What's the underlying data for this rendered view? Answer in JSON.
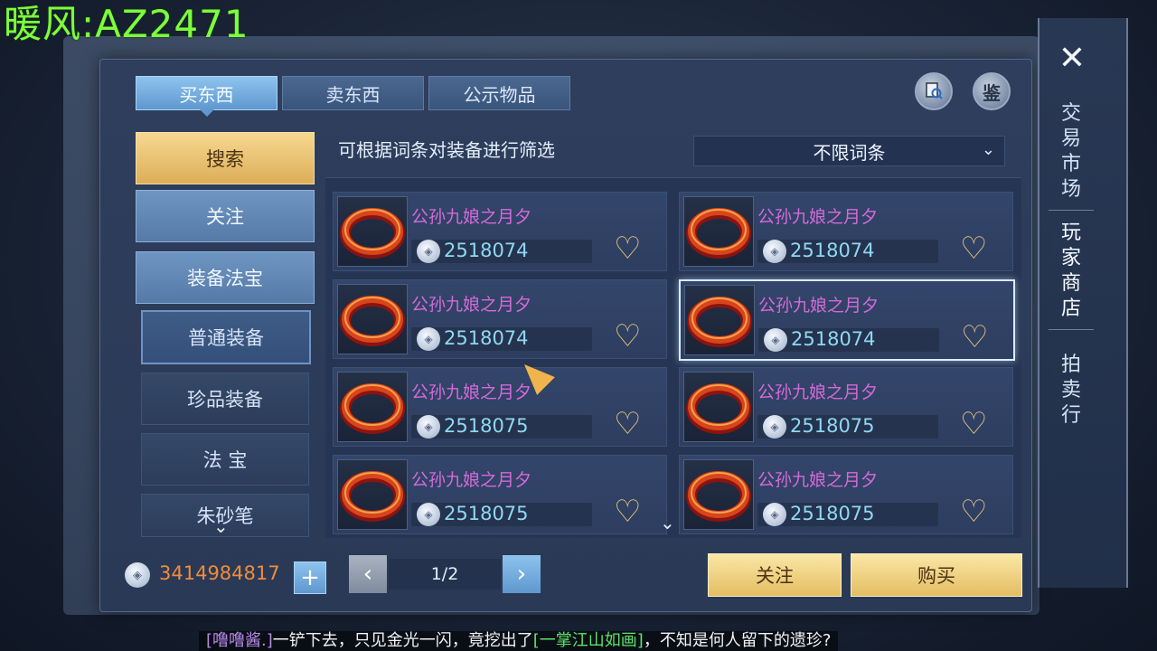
{
  "watermark": "暖风:AZ2471",
  "tabs": [
    {
      "label": "买东西",
      "active": true
    },
    {
      "label": "卖东西",
      "active": false
    },
    {
      "label": "公示物品",
      "active": false
    }
  ],
  "header_buttons": {
    "appraise_label": "鉴"
  },
  "menu": {
    "search": "搜索",
    "follow": "关注",
    "equip_treasure": "装备法宝",
    "normal_equip": "普通装备",
    "rare_equip": "珍品装备",
    "treasure": "法 宝",
    "cinnabar_pen": "朱砂笔"
  },
  "filter": {
    "label": "可根据词条对装备进行筛选",
    "selected": "不限词条"
  },
  "items": [
    {
      "name": "公孙九娘之月夕",
      "price": "2518074",
      "selected": false
    },
    {
      "name": "公孙九娘之月夕",
      "price": "2518074",
      "selected": false
    },
    {
      "name": "公孙九娘之月夕",
      "price": "2518074",
      "selected": false
    },
    {
      "name": "公孙九娘之月夕",
      "price": "2518074",
      "selected": true
    },
    {
      "name": "公孙九娘之月夕",
      "price": "2518075",
      "selected": false
    },
    {
      "name": "公孙九娘之月夕",
      "price": "2518075",
      "selected": false
    },
    {
      "name": "公孙九娘之月夕",
      "price": "2518075",
      "selected": false
    },
    {
      "name": "公孙九娘之月夕",
      "price": "2518075",
      "selected": false
    }
  ],
  "bottom": {
    "balance": "3414984817",
    "page": "1/2",
    "follow_button": "关注",
    "buy_button": "购买"
  },
  "side_nav": {
    "trade_market": "交易市场",
    "player_shop": "玩家商店",
    "auction": "拍卖行"
  },
  "chat": {
    "nick": "[噜噜酱.]",
    "text1": "一铲下去，只见金光一闪，竟挖出了",
    "item": "[一掌江山如画]",
    "text2": "，不知是何人留下的遗珍?"
  },
  "colors": {
    "accent": "#5f98cf",
    "gold": "#e4bd63",
    "item_name": "#d46ad8",
    "price": "#8fd8f2",
    "balance": "#f08c3c"
  }
}
